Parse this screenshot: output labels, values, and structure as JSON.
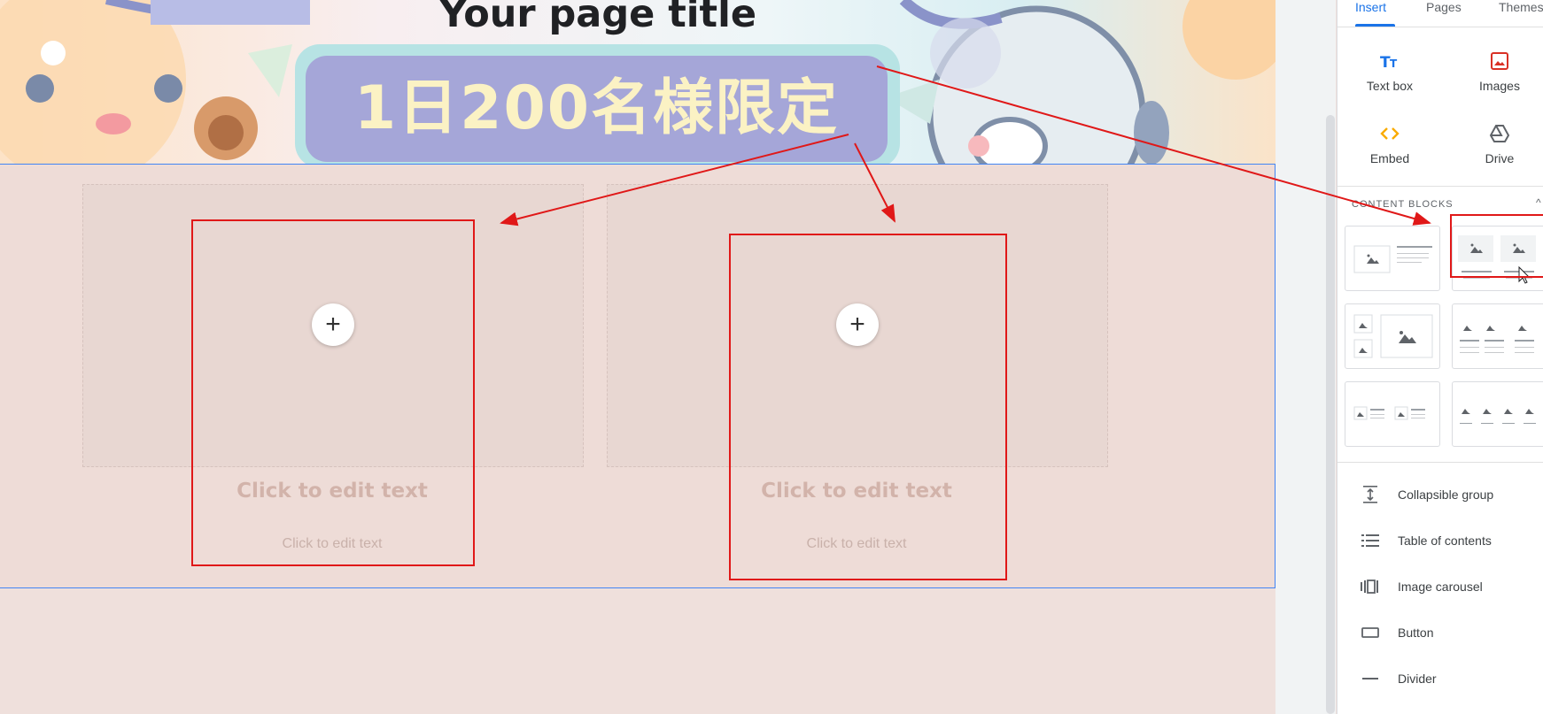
{
  "canvas": {
    "page_title": "Your page title",
    "promo_label": "1日200名様限定",
    "blocks": [
      {
        "add_icon": "plus-icon",
        "title": "Click to edit text",
        "body": "Click to edit text"
      },
      {
        "add_icon": "plus-icon",
        "title": "Click to edit text",
        "body": "Click to edit text"
      }
    ]
  },
  "panel": {
    "tabs": [
      {
        "label": "Insert",
        "active": true
      },
      {
        "label": "Pages",
        "active": false
      },
      {
        "label": "Themes",
        "active": false
      }
    ],
    "tools": [
      {
        "label": "Text box",
        "icon": "text-box-icon",
        "color": "#1a73e8"
      },
      {
        "label": "Images",
        "icon": "image-icon",
        "color": "#d93025"
      },
      {
        "label": "Embed",
        "icon": "embed-code-icon",
        "color": "#f9ab00"
      },
      {
        "label": "Drive",
        "icon": "drive-icon",
        "color": "#5f6368"
      }
    ],
    "content_blocks_header": "CONTENT BLOCKS",
    "content_blocks": [
      "image-with-text-layout",
      "two-images-with-text-layout",
      "image-grid-layout",
      "three-images-with-text-layout",
      "two-small-images-text-layout",
      "four-images-layout"
    ],
    "items": [
      {
        "label": "Collapsible group",
        "icon": "collapsible-group-icon"
      },
      {
        "label": "Table of contents",
        "icon": "table-of-contents-icon"
      },
      {
        "label": "Image carousel",
        "icon": "image-carousel-icon"
      },
      {
        "label": "Button",
        "icon": "button-icon"
      },
      {
        "label": "Divider",
        "icon": "divider-icon"
      }
    ]
  },
  "colors": {
    "accent": "#1a73e8",
    "annotation": "#e01818",
    "selection_outline": "#4285f4",
    "section_background": "#eedcd7"
  }
}
